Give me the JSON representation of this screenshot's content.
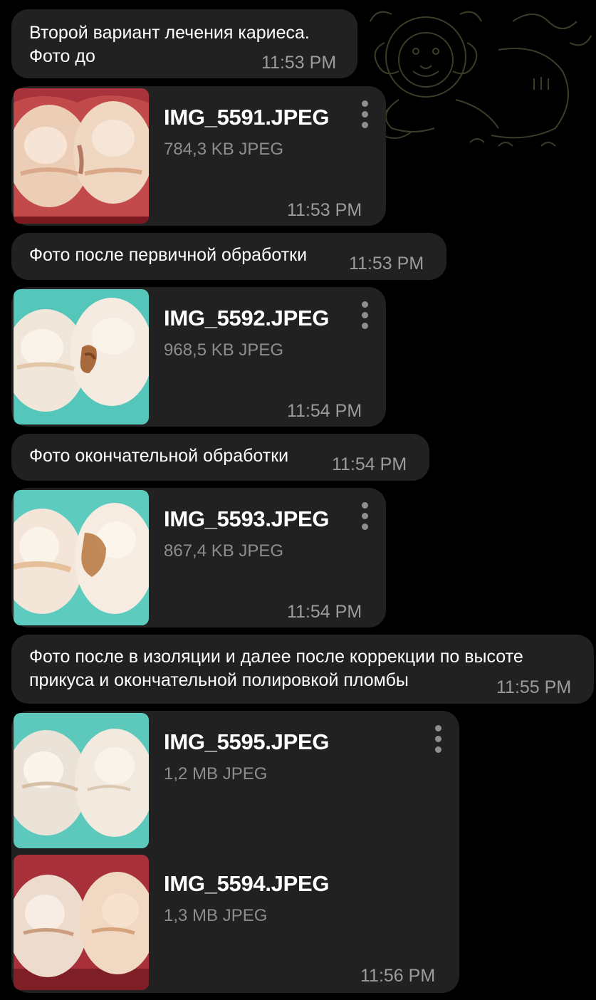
{
  "messages": [
    {
      "text": "Второй вариант лечения кариеса.\nФото до",
      "time": "11:53 PM"
    },
    {
      "file": {
        "name": "IMG_5591.JPEG",
        "meta": "784,3 KB JPEG",
        "thumb": "red-gum-teeth"
      },
      "time": "11:53 PM"
    },
    {
      "text": "Фото после первичной обработки",
      "time": "11:53 PM"
    },
    {
      "file": {
        "name": "IMG_5592.JPEG",
        "meta": "968,5 KB JPEG",
        "thumb": "teal-dam-cavity"
      },
      "time": "11:54 PM"
    },
    {
      "text": "Фото окончательной обработки",
      "time": "11:54 PM"
    },
    {
      "file": {
        "name": "IMG_5593.JPEG",
        "meta": "867,4 KB JPEG",
        "thumb": "teal-dam-prepared"
      },
      "time": "11:54 PM"
    },
    {
      "text": "Фото после в изоляции и далее после коррекции по высоте\nприкуса и окончательной полировкой пломбы",
      "time": "11:55 PM"
    },
    {
      "files": [
        {
          "name": "IMG_5595.JPEG",
          "meta": "1,2 MB JPEG",
          "thumb": "teal-dam-filled"
        },
        {
          "name": "IMG_5594.JPEG",
          "meta": "1,3 MB JPEG",
          "thumb": "red-gum-filled"
        }
      ],
      "time": "11:56 PM"
    }
  ],
  "icons": {
    "menu": "more-vertical-icon",
    "background": "lion-doodle-pattern"
  },
  "colors": {
    "background": "#000000",
    "bubble": "#212121",
    "time": "#9c9c9c",
    "meta": "#8d8d8d",
    "doodle": "#8f8d62"
  }
}
